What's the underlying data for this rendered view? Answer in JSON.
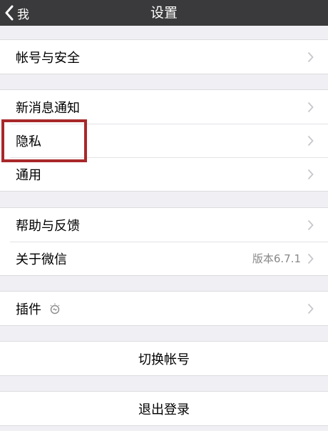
{
  "navbar": {
    "back_label": "我",
    "title": "设置"
  },
  "groups": [
    {
      "rows": [
        {
          "label": "帐号与安全"
        }
      ]
    },
    {
      "rows": [
        {
          "label": "新消息通知"
        },
        {
          "label": "隐私"
        },
        {
          "label": "通用"
        }
      ]
    },
    {
      "rows": [
        {
          "label": "帮助与反馈"
        },
        {
          "label": "关于微信",
          "value": "版本6.7.1"
        }
      ]
    },
    {
      "rows": [
        {
          "label": "插件"
        }
      ]
    },
    {
      "rows": [
        {
          "label": "切换帐号"
        }
      ]
    },
    {
      "rows": [
        {
          "label": "退出登录"
        }
      ]
    }
  ],
  "highlight_color": "#a8282a",
  "navbar_color": "#3a3a3c"
}
